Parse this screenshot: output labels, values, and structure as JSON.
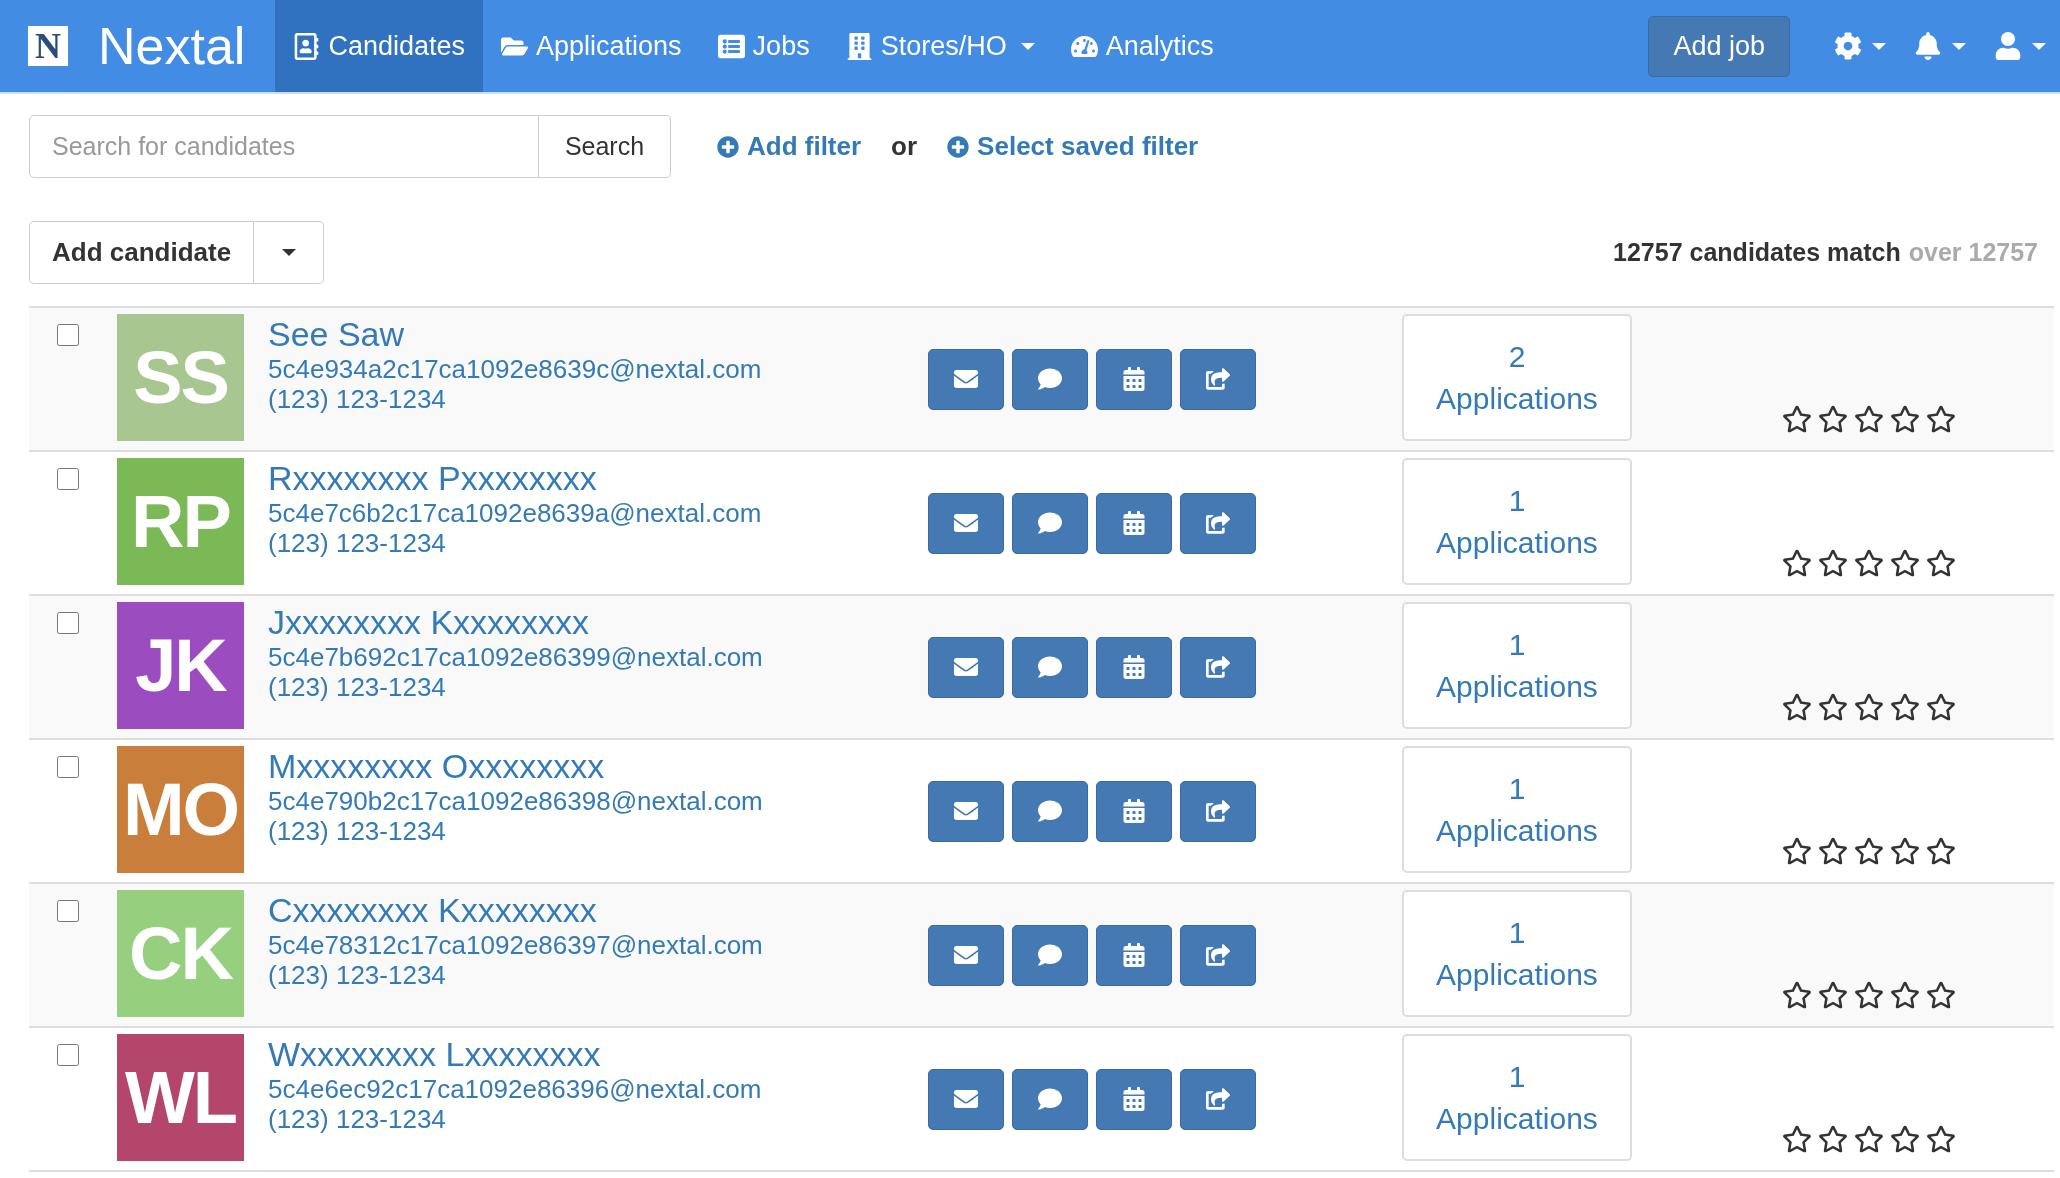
{
  "navbar": {
    "logo_letter": "N",
    "brand": "Nextal",
    "items": [
      {
        "kind": "candidates",
        "label": "Candidates",
        "selected": true,
        "dropdown": false
      },
      {
        "kind": "applications",
        "label": "Applications",
        "selected": false,
        "dropdown": false
      },
      {
        "kind": "jobs",
        "label": "Jobs",
        "selected": false,
        "dropdown": false
      },
      {
        "kind": "stores",
        "label": "Stores/HO",
        "selected": false,
        "dropdown": true
      },
      {
        "kind": "analytics",
        "label": "Analytics",
        "selected": false,
        "dropdown": false
      }
    ],
    "add_job": "Add job"
  },
  "search": {
    "placeholder": "Search for candidates",
    "button": "Search"
  },
  "filters": {
    "add_filter": "Add filter",
    "or": "or",
    "saved_filter": "Select saved filter"
  },
  "add_candidate": "Add candidate",
  "match": {
    "count": "12757 candidates match",
    "total": "over 12757"
  },
  "candidates": [
    {
      "initials": "SS",
      "color": "#a8c68f",
      "name": "See Saw",
      "email": "5c4e934a2c17ca1092e8639c@nextal.com",
      "phone": "(123) 123-1234",
      "applications_count": "2",
      "applications_label": "Applications",
      "stars": 0,
      "checked": false
    },
    {
      "initials": "RP",
      "color": "#7ab956",
      "name": "Rxxxxxxxx Pxxxxxxxx",
      "email": "5c4e7c6b2c17ca1092e8639a@nextal.com",
      "phone": "(123) 123-1234",
      "applications_count": "1",
      "applications_label": "Applications",
      "stars": 0,
      "checked": false
    },
    {
      "initials": "JK",
      "color": "#9b4dbf",
      "name": "Jxxxxxxxx Kxxxxxxxx",
      "email": "5c4e7b692c17ca1092e86399@nextal.com",
      "phone": "(123) 123-1234",
      "applications_count": "1",
      "applications_label": "Applications",
      "stars": 0,
      "checked": false
    },
    {
      "initials": "MO",
      "color": "#c97e3c",
      "name": "Mxxxxxxxx Oxxxxxxxx",
      "email": "5c4e790b2c17ca1092e86398@nextal.com",
      "phone": "(123) 123-1234",
      "applications_count": "1",
      "applications_label": "Applications",
      "stars": 0,
      "checked": false
    },
    {
      "initials": "CK",
      "color": "#96d07f",
      "name": "Cxxxxxxxx Kxxxxxxxx",
      "email": "5c4e78312c17ca1092e86397@nextal.com",
      "phone": "(123) 123-1234",
      "applications_count": "1",
      "applications_label": "Applications",
      "stars": 0,
      "checked": false
    },
    {
      "initials": "WL",
      "color": "#b3466a",
      "name": "Wxxxxxxxx Lxxxxxxxx",
      "email": "5c4e6ec92c17ca1092e86396@nextal.com",
      "phone": "(123) 123-1234",
      "applications_count": "1",
      "applications_label": "Applications",
      "stars": 0,
      "checked": false
    }
  ]
}
